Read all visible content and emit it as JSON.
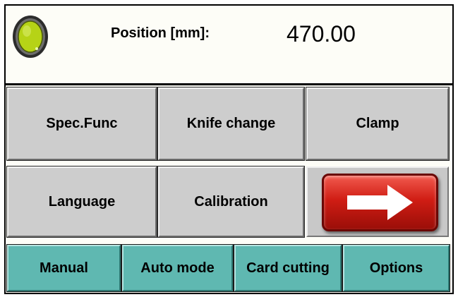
{
  "header": {
    "indicator_color": "#b6d316",
    "position_label": "Position  [mm]:",
    "position_value": "470.00"
  },
  "buttons": {
    "row1": [
      "Spec.Func",
      "Knife change",
      "Clamp"
    ],
    "row2": [
      "Language",
      "Calibration"
    ],
    "next_icon": "right-arrow-icon",
    "next_color": "#d8241a"
  },
  "nav": {
    "tabs": [
      "Manual",
      "Auto mode",
      "Card cutting",
      "Options"
    ],
    "tab_color": "#5fb8b1"
  }
}
